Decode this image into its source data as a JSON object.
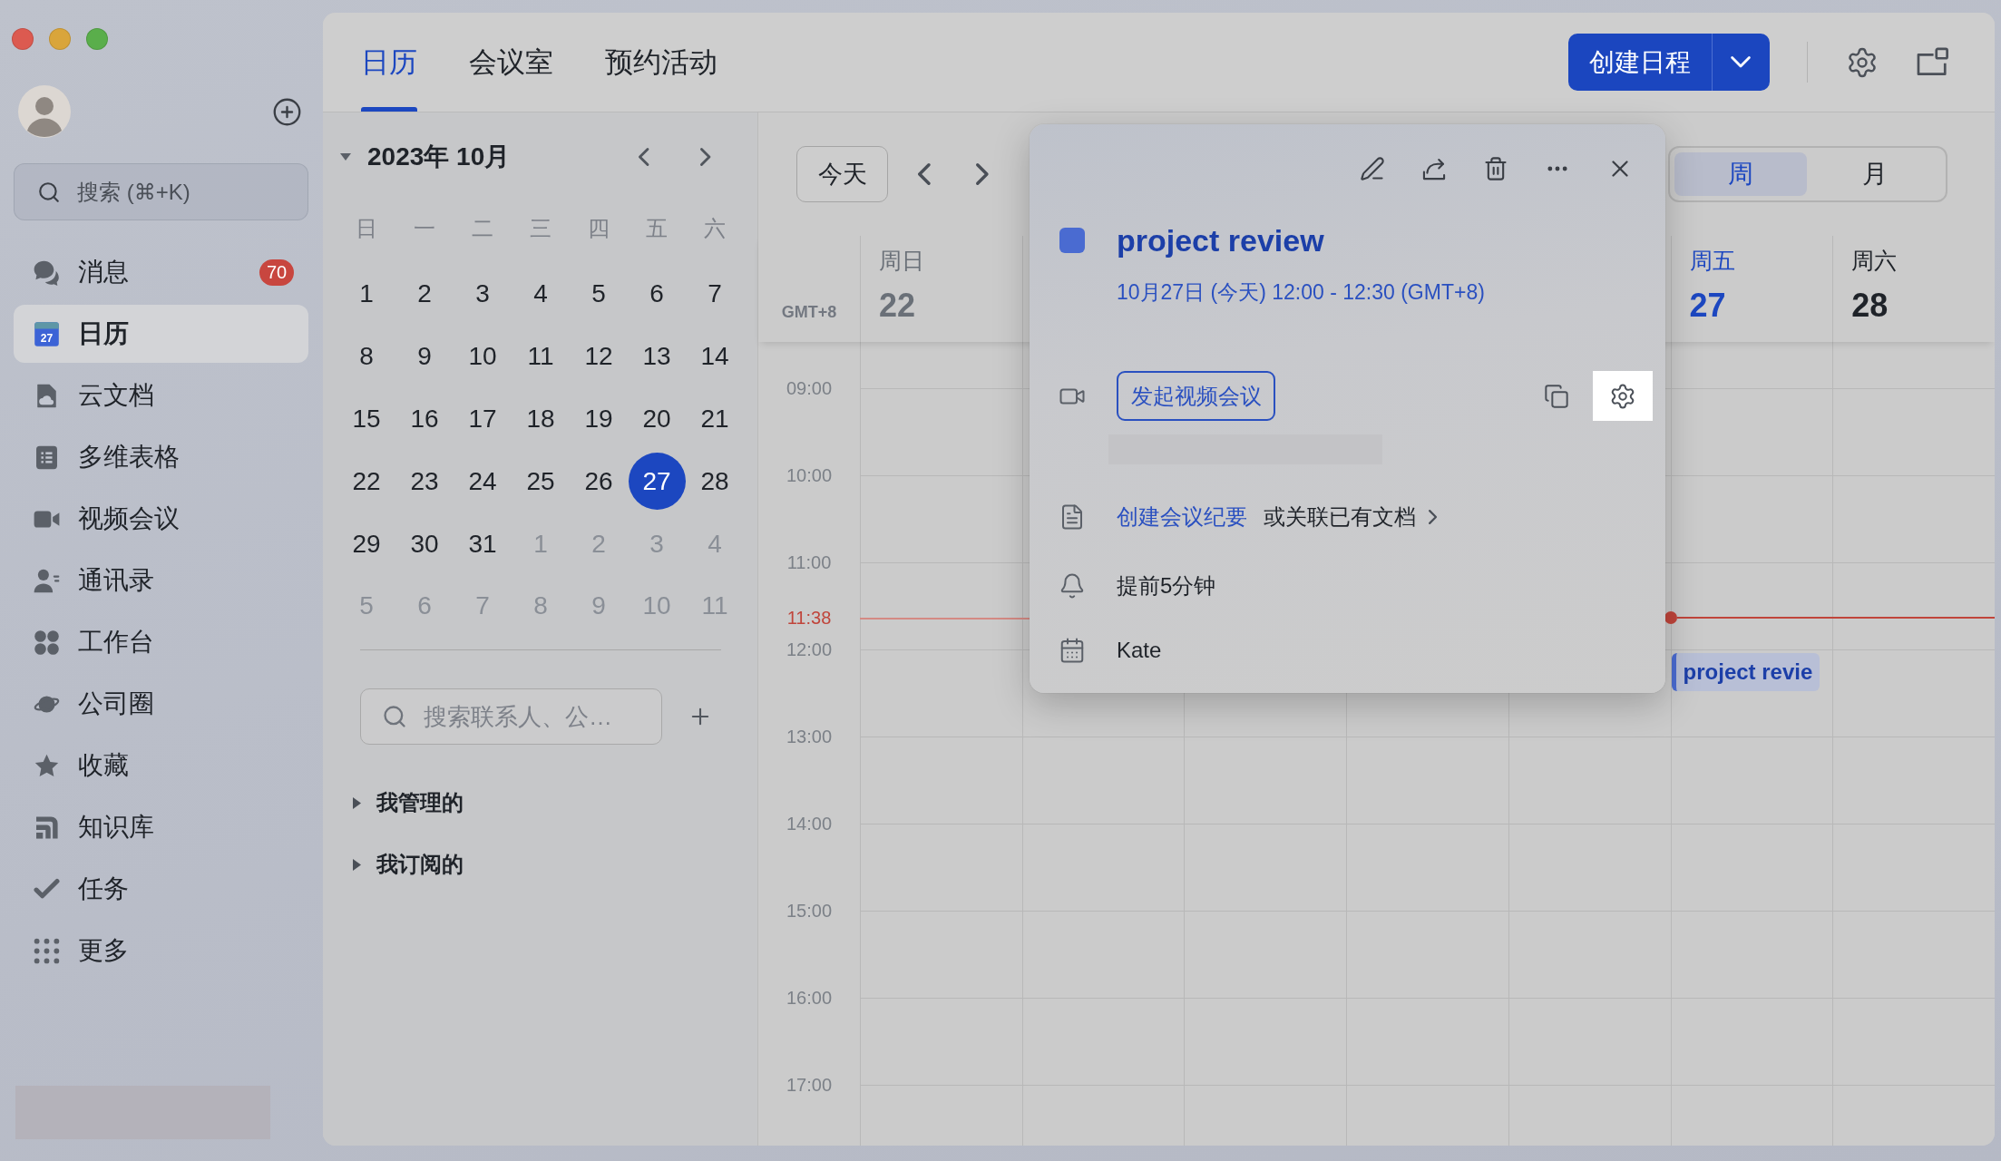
{
  "sidebar": {
    "search": {
      "placeholder": "搜索 (⌘+K)"
    },
    "items": [
      {
        "label": "消息",
        "selected": false,
        "badge": "70"
      },
      {
        "label": "日历",
        "selected": true,
        "icon_text": "27"
      },
      {
        "label": "云文档",
        "selected": false
      },
      {
        "label": "多维表格",
        "selected": false
      },
      {
        "label": "视频会议",
        "selected": false
      },
      {
        "label": "通讯录",
        "selected": false
      },
      {
        "label": "工作台",
        "selected": false
      },
      {
        "label": "公司圈",
        "selected": false
      },
      {
        "label": "收藏",
        "selected": false
      },
      {
        "label": "知识库",
        "selected": false
      },
      {
        "label": "任务",
        "selected": false
      },
      {
        "label": "更多",
        "selected": false
      }
    ]
  },
  "tabs": [
    {
      "label": "日历",
      "selected": true
    },
    {
      "label": "会议室",
      "selected": false
    },
    {
      "label": "预约活动",
      "selected": false
    }
  ],
  "create_button": {
    "label": "创建日程"
  },
  "mini_calendar": {
    "title": "2023年 10月",
    "expanded": true,
    "weekdays": [
      "日",
      "一",
      "二",
      "三",
      "四",
      "五",
      "六"
    ],
    "days": [
      {
        "label": "1",
        "in_month": true,
        "selected": false
      },
      {
        "label": "2",
        "in_month": true,
        "selected": false
      },
      {
        "label": "3",
        "in_month": true,
        "selected": false
      },
      {
        "label": "4",
        "in_month": true,
        "selected": false
      },
      {
        "label": "5",
        "in_month": true,
        "selected": false
      },
      {
        "label": "6",
        "in_month": true,
        "selected": false
      },
      {
        "label": "7",
        "in_month": true,
        "selected": false
      },
      {
        "label": "8",
        "in_month": true,
        "selected": false
      },
      {
        "label": "9",
        "in_month": true,
        "selected": false
      },
      {
        "label": "10",
        "in_month": true,
        "selected": false
      },
      {
        "label": "11",
        "in_month": true,
        "selected": false
      },
      {
        "label": "12",
        "in_month": true,
        "selected": false
      },
      {
        "label": "13",
        "in_month": true,
        "selected": false
      },
      {
        "label": "14",
        "in_month": true,
        "selected": false
      },
      {
        "label": "15",
        "in_month": true,
        "selected": false
      },
      {
        "label": "16",
        "in_month": true,
        "selected": false
      },
      {
        "label": "17",
        "in_month": true,
        "selected": false
      },
      {
        "label": "18",
        "in_month": true,
        "selected": false
      },
      {
        "label": "19",
        "in_month": true,
        "selected": false
      },
      {
        "label": "20",
        "in_month": true,
        "selected": false
      },
      {
        "label": "21",
        "in_month": true,
        "selected": false
      },
      {
        "label": "22",
        "in_month": true,
        "selected": false
      },
      {
        "label": "23",
        "in_month": true,
        "selected": false
      },
      {
        "label": "24",
        "in_month": true,
        "selected": false
      },
      {
        "label": "25",
        "in_month": true,
        "selected": false
      },
      {
        "label": "26",
        "in_month": true,
        "selected": false
      },
      {
        "label": "27",
        "in_month": true,
        "selected": true
      },
      {
        "label": "28",
        "in_month": true,
        "selected": false
      },
      {
        "label": "29",
        "in_month": true,
        "selected": false
      },
      {
        "label": "30",
        "in_month": true,
        "selected": false
      },
      {
        "label": "31",
        "in_month": true,
        "selected": false
      },
      {
        "label": "1",
        "in_month": false,
        "selected": false
      },
      {
        "label": "2",
        "in_month": false,
        "selected": false
      },
      {
        "label": "3",
        "in_month": false,
        "selected": false
      },
      {
        "label": "4",
        "in_month": false,
        "selected": false
      },
      {
        "label": "5",
        "in_month": false,
        "selected": false
      },
      {
        "label": "6",
        "in_month": false,
        "selected": false
      },
      {
        "label": "7",
        "in_month": false,
        "selected": false
      },
      {
        "label": "8",
        "in_month": false,
        "selected": false
      },
      {
        "label": "9",
        "in_month": false,
        "selected": false
      },
      {
        "label": "10",
        "in_month": false,
        "selected": false
      },
      {
        "label": "11",
        "in_month": false,
        "selected": false
      }
    ],
    "search": {
      "placeholder": "搜索联系人、公…"
    },
    "groups": [
      {
        "label": "我管理的",
        "expanded": false
      },
      {
        "label": "我订阅的",
        "expanded": false
      }
    ]
  },
  "week_view": {
    "today_button": "今天",
    "views": [
      {
        "label": "周",
        "selected": true
      },
      {
        "label": "月",
        "selected": false
      }
    ],
    "timezone": "GMT+8",
    "days": [
      {
        "weekday": "周日",
        "date": "22",
        "today": false,
        "past": true
      },
      {
        "weekday": "周五",
        "date": "27",
        "today": true,
        "past": false
      },
      {
        "weekday": "周六",
        "date": "28",
        "today": false,
        "past": false
      }
    ],
    "hours": [
      "09:00",
      "10:00",
      "11:00",
      "12:00",
      "13:00",
      "14:00",
      "15:00",
      "16:00",
      "17:00"
    ],
    "current_time": "11:38",
    "events": [
      {
        "title": "project revie"
      }
    ]
  },
  "event_popup": {
    "title": "project review",
    "time": "10月27日 (今天) 12:00 - 12:30 (GMT+8)",
    "video_button": "发起视频会议",
    "video_settings_highlighted": true,
    "notes_link": "创建会议纪要",
    "notes_hint": "或关联已有文档",
    "reminder": "提前5分钟",
    "calendar": "Kate"
  }
}
